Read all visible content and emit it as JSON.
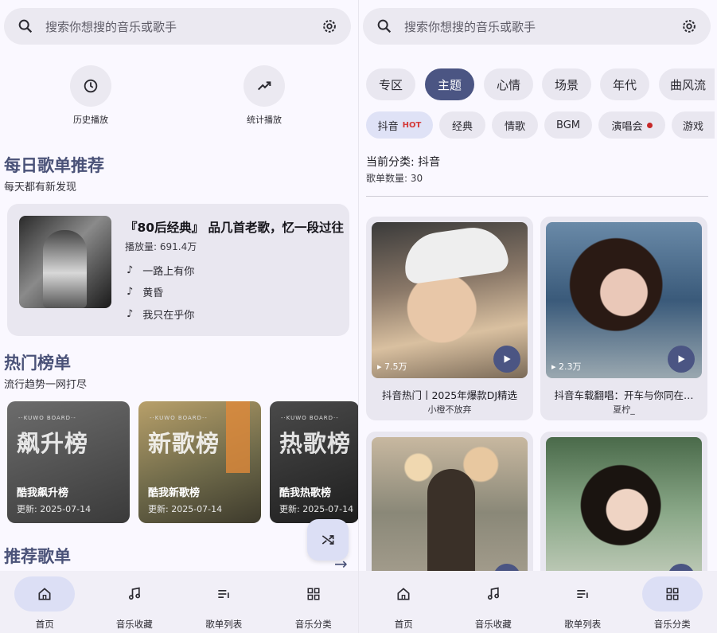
{
  "left": {
    "search": {
      "placeholder": "搜索你想搜的音乐或歌手",
      "icon": "search-icon",
      "settings_icon": "gear-icon"
    },
    "quick": [
      {
        "label": "历史播放",
        "icon": "history-icon"
      },
      {
        "label": "统计播放",
        "icon": "trending-icon"
      }
    ],
    "daily": {
      "title": "每日歌单推荐",
      "subtitle": "每天都有新发现",
      "playlist": {
        "title": "『80后经典』 品几首老歌，忆一段过往",
        "plays": "播放量: 691.4万",
        "songs": [
          "一路上有你",
          "黄昏",
          "我只在乎你"
        ]
      }
    },
    "hot": {
      "title": "热门榜单",
      "subtitle": "流行趋势一网打尽",
      "charts": [
        {
          "board": "-·KUWO BOARD·-",
          "big": "飙升榜",
          "name": "酷我飙升榜",
          "date": "更新: 2025-07-14",
          "color": "#5f5f5f"
        },
        {
          "board": "-·KUWO BOARD·-",
          "big": "新歌榜",
          "name": "酷我新歌榜",
          "date": "更新: 2025-07-14",
          "color": "#9a8a62"
        },
        {
          "board": "-·KUWO BOARD·-",
          "big": "热歌榜",
          "name": "酷我热歌榜",
          "date": "更新: 2025-07-14",
          "color": "#2f2f2f"
        }
      ]
    },
    "recommend": {
      "title": "推荐歌单"
    },
    "fab_icon": "shuffle-icon"
  },
  "right": {
    "search": {
      "placeholder": "搜索你想搜的音乐或歌手"
    },
    "categories": [
      "专区",
      "主题",
      "心情",
      "场景",
      "年代",
      "曲风流"
    ],
    "active_category": "主题",
    "subcategories": [
      "抖音",
      "经典",
      "情歌",
      "BGM",
      "演唱会",
      "游戏"
    ],
    "hot_badge": "HOT",
    "current_category": "当前分类: 抖音",
    "playlist_count": "歌单数量: 30",
    "playlists": [
      {
        "plays": "▸ 7.5万",
        "title": "抖音热门丨2025年爆款DJ精选",
        "author": "小橙不放弃"
      },
      {
        "plays": "▸ 2.3万",
        "title": "抖音车载翻唱：开车与你同在…",
        "author": "夏柠_"
      },
      {
        "plays": "",
        "title": "",
        "author": ""
      },
      {
        "plays": "",
        "title": "",
        "author": ""
      }
    ]
  },
  "nav": [
    "首页",
    "音乐收藏",
    "歌单列表",
    "音乐分类"
  ],
  "colors": {
    "accent": "#4b5583",
    "active_pill": "#dcdff5",
    "title": "#4a5278"
  }
}
